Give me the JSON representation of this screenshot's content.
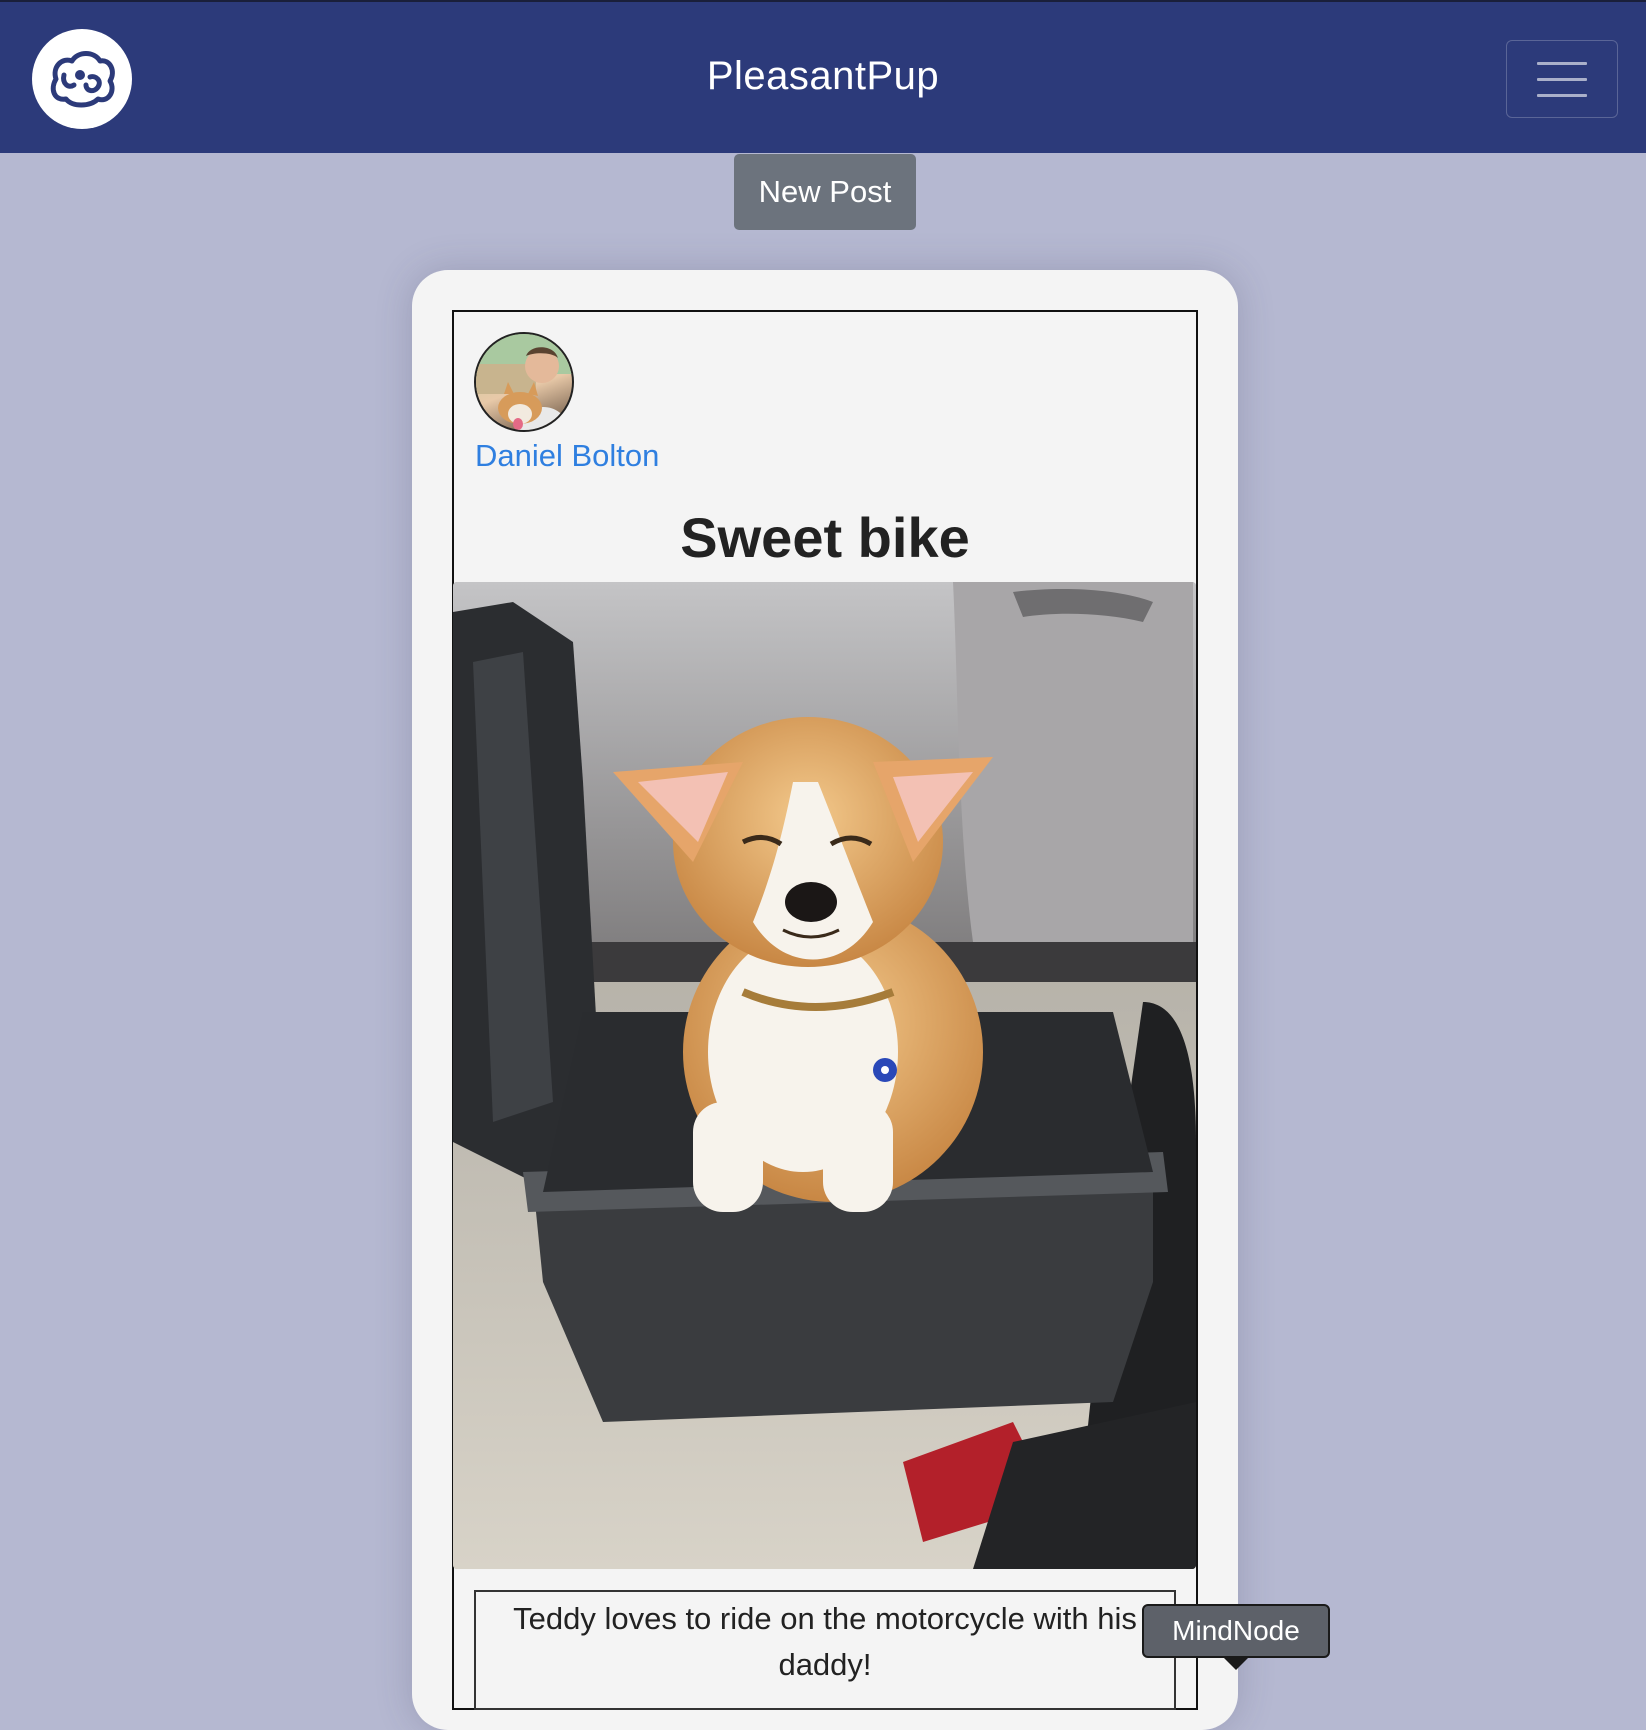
{
  "navbar": {
    "brand": "PleasantPup",
    "logo_icon": "dog-face-icon",
    "menu_icon": "hamburger-menu-icon",
    "background_color": "#2c3a7a"
  },
  "actions": {
    "new_post_label": "New Post"
  },
  "post": {
    "author_name": "Daniel Bolton",
    "title": "Sweet bike",
    "caption": "Teddy loves to ride on the motorcycle with his daddy!",
    "photo_subject": "corgi-puppy-in-motorcycle-top-case"
  },
  "tooltip": {
    "label": "MindNode"
  },
  "colors": {
    "page_background": "#b5b8d1",
    "author_link": "#2f7fe0",
    "button_gray": "#6c737d"
  }
}
